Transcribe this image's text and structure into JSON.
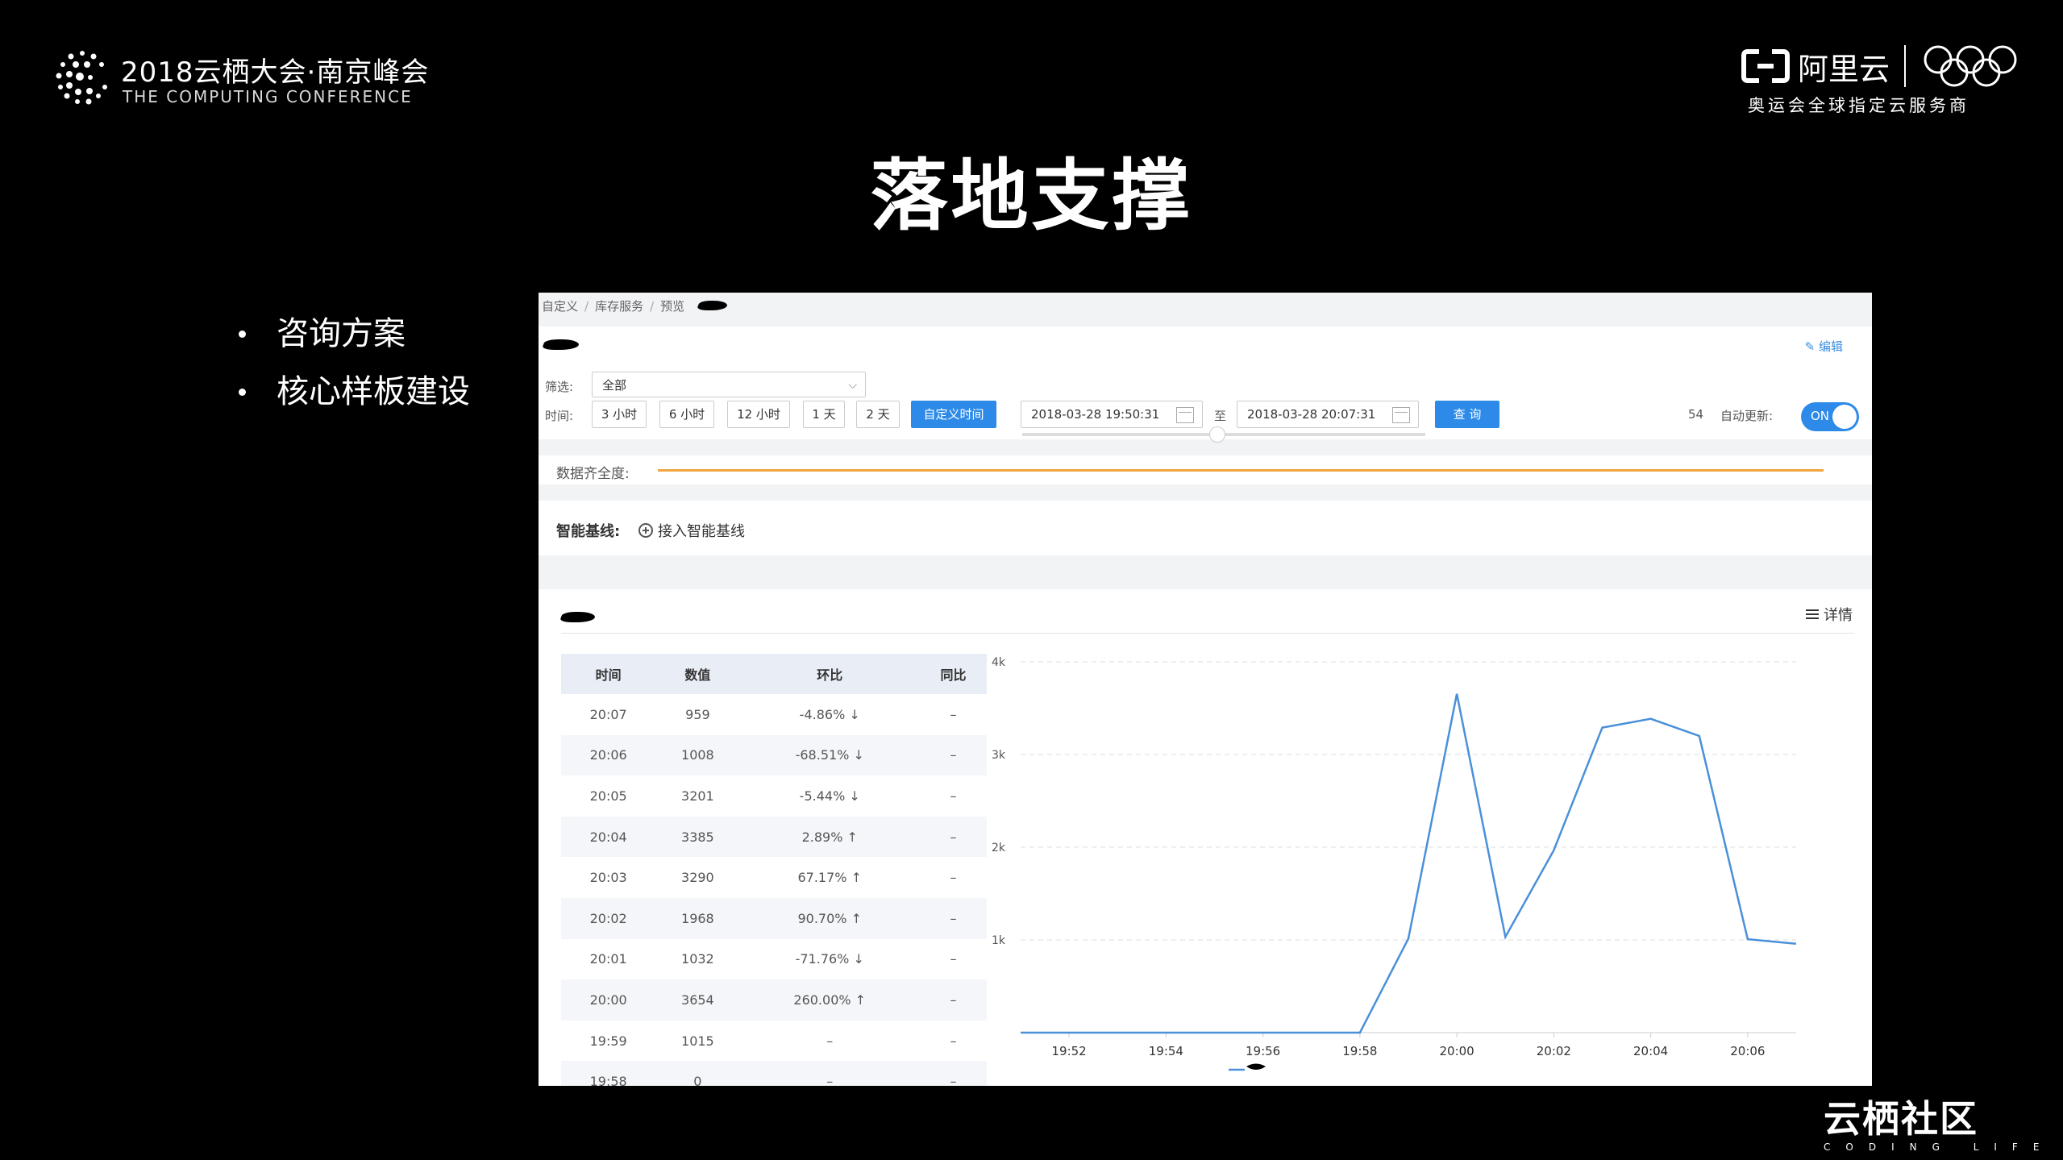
{
  "slide": {
    "conf_title": "2018云栖大会·南京峰会",
    "conf_subtitle": "THE COMPUTING CONFERENCE",
    "brand_name": "阿里云",
    "brand_sub": "奥运会全球指定云服务商",
    "title": "落地支撑",
    "bullets": [
      "咨询方案",
      "核心样板建设"
    ],
    "footer_logo": "云栖社区",
    "footer_sub": "CODING LIFE"
  },
  "screenshot": {
    "breadcrumb": [
      "自定义",
      "库存服务",
      "预览"
    ],
    "edit_label": "编辑",
    "filter_label": "筛选:",
    "filter_value": "全部",
    "time_label": "时间:",
    "time_buttons": [
      "3 小时",
      "6 小时",
      "12 小时",
      "1 天",
      "2 天"
    ],
    "custom_time_label": "自定义时间",
    "start_time": "2018-03-28 19:50:31",
    "to_label": "至",
    "end_time": "2018-03-28 20:07:31",
    "query_label": "查 询",
    "countdown": "54",
    "auto_refresh_label": "自动更新:",
    "toggle_label": "ON",
    "completeness_label": "数据齐全度:",
    "baseline_label": "智能基线:",
    "add_baseline_label": "接入智能基线",
    "detail_label": "详情",
    "table": {
      "headers": [
        "时间",
        "数值",
        "环比",
        "同比"
      ],
      "rows": [
        {
          "time": "20:07",
          "value": "959",
          "mom": "-4.86%",
          "dir": "down",
          "yoy": "–"
        },
        {
          "time": "20:06",
          "value": "1008",
          "mom": "-68.51%",
          "dir": "down",
          "yoy": "–"
        },
        {
          "time": "20:05",
          "value": "3201",
          "mom": "-5.44%",
          "dir": "down",
          "yoy": "–"
        },
        {
          "time": "20:04",
          "value": "3385",
          "mom": "2.89%",
          "dir": "up",
          "yoy": "–"
        },
        {
          "time": "20:03",
          "value": "3290",
          "mom": "67.17%",
          "dir": "up",
          "yoy": "–"
        },
        {
          "time": "20:02",
          "value": "1968",
          "mom": "90.70%",
          "dir": "up",
          "yoy": "–"
        },
        {
          "time": "20:01",
          "value": "1032",
          "mom": "-71.76%",
          "dir": "down",
          "yoy": "–"
        },
        {
          "time": "20:00",
          "value": "3654",
          "mom": "260.00%",
          "dir": "up",
          "yoy": "–"
        },
        {
          "time": "19:59",
          "value": "1015",
          "mom": "–",
          "dir": "",
          "yoy": "–"
        },
        {
          "time": "19:58",
          "value": "0",
          "mom": "–",
          "dir": "",
          "yoy": "–"
        }
      ]
    }
  },
  "chart_data": {
    "type": "line",
    "x": [
      "19:51",
      "19:52",
      "19:53",
      "19:54",
      "19:55",
      "19:56",
      "19:57",
      "19:58",
      "19:59",
      "20:00",
      "20:01",
      "20:02",
      "20:03",
      "20:04",
      "20:05",
      "20:06",
      "20:07"
    ],
    "xticks": [
      "19:52",
      "19:54",
      "19:56",
      "19:58",
      "20:00",
      "20:02",
      "20:04",
      "20:06"
    ],
    "series": [
      {
        "values": [
          0,
          0,
          0,
          0,
          0,
          0,
          0,
          0,
          1015,
          3654,
          1032,
          1968,
          3290,
          3385,
          3201,
          1008,
          959
        ]
      }
    ],
    "yticks": [
      "1k",
      "2k",
      "3k",
      "4k"
    ],
    "ylim": [
      0,
      4000
    ],
    "grid": true,
    "color": "#4a90d9"
  }
}
